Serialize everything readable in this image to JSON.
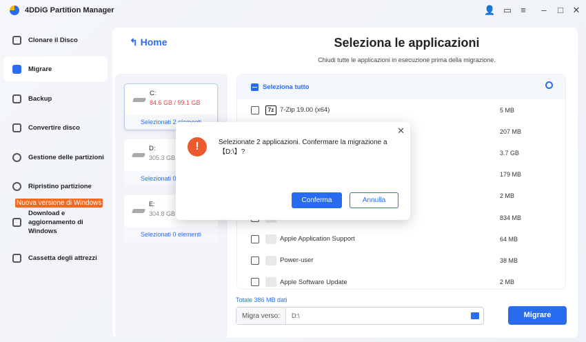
{
  "app": {
    "title": "4DDiG Partition Manager"
  },
  "window_icons": [
    "user-icon",
    "message-icon",
    "menu-icon",
    "minimize-icon",
    "maximize-icon",
    "close-icon"
  ],
  "sidebar": {
    "items": [
      {
        "label": "Clonare il Disco"
      },
      {
        "label": "Migrare"
      },
      {
        "label": "Backup"
      },
      {
        "label": "Convertire disco"
      },
      {
        "label": "Gestione delle partizioni"
      },
      {
        "label": "Ripristino partizione"
      },
      {
        "label": "Download e aggiornamento di Windows"
      },
      {
        "label": "Cassetta degli attrezzi"
      }
    ],
    "badge": "Nuova versione di Windows"
  },
  "main": {
    "home": "Home",
    "title": "Seleziona le applicazioni",
    "subtitle": "Chiudi tutte le applicazioni in esecuzione prima della migrazione."
  },
  "drives": [
    {
      "name": "C:",
      "size": "84.6 GB / 99.1 GB",
      "selected": "Selezionati 2 elementi"
    },
    {
      "name": "D:",
      "size": "305.3 GB",
      "selected": "Selezionati 0 elementi"
    },
    {
      "name": "E:",
      "size": "304.8 GB",
      "selected": "Selezionati 0 elementi"
    }
  ],
  "apps": {
    "select_all": "Seleziona tutto",
    "rows": [
      {
        "name": "7-Zip 19.00 (x64)",
        "size": "5 MB"
      },
      {
        "name": "",
        "size": "207 MB"
      },
      {
        "name": "",
        "size": "3.7 GB"
      },
      {
        "name": "",
        "size": "179 MB"
      },
      {
        "name": "",
        "size": "2 MB"
      },
      {
        "name": "",
        "size": "834 MB"
      },
      {
        "name": "Apple Application Support",
        "size": "64 MB"
      },
      {
        "name": "Power-user",
        "size": "38 MB"
      },
      {
        "name": "Apple Software Update",
        "size": "2 MB"
      }
    ]
  },
  "footer": {
    "total": "Totale 386 MB dati",
    "dest_label": "Migra verso:",
    "dest_value": "D:\\",
    "migrate": "Migrare"
  },
  "dialog": {
    "message": "Selezionate 2 applicazioni. Confermare la migrazione a 【D:\\】?",
    "confirm": "Conferma",
    "cancel": "Annulla"
  }
}
